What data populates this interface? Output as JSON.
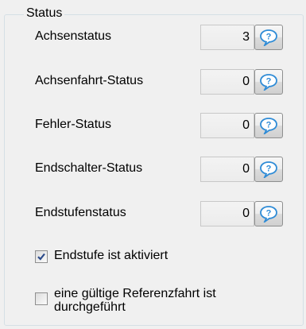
{
  "group": {
    "title": "Status"
  },
  "rows": [
    {
      "label": "Achsenstatus",
      "value": "3"
    },
    {
      "label": "Achsenfahrt-Status",
      "value": "0"
    },
    {
      "label": "Fehler-Status",
      "value": "0"
    },
    {
      "label": "Endschalter-Status",
      "value": "0"
    },
    {
      "label": "Endstufenstatus",
      "value": "0"
    }
  ],
  "checkboxes": [
    {
      "label": "Endstufe ist aktiviert",
      "checked": true
    },
    {
      "label_line1": "eine gültige Referenzfahrt ist",
      "label_line2": "durchgeführt",
      "checked": false
    }
  ],
  "icons": {
    "help": "help-speech-bubble-icon",
    "check": "checkmark-icon"
  },
  "colors": {
    "help_icon": "#2e8bd6",
    "check_mark": "#2c4b8a"
  }
}
